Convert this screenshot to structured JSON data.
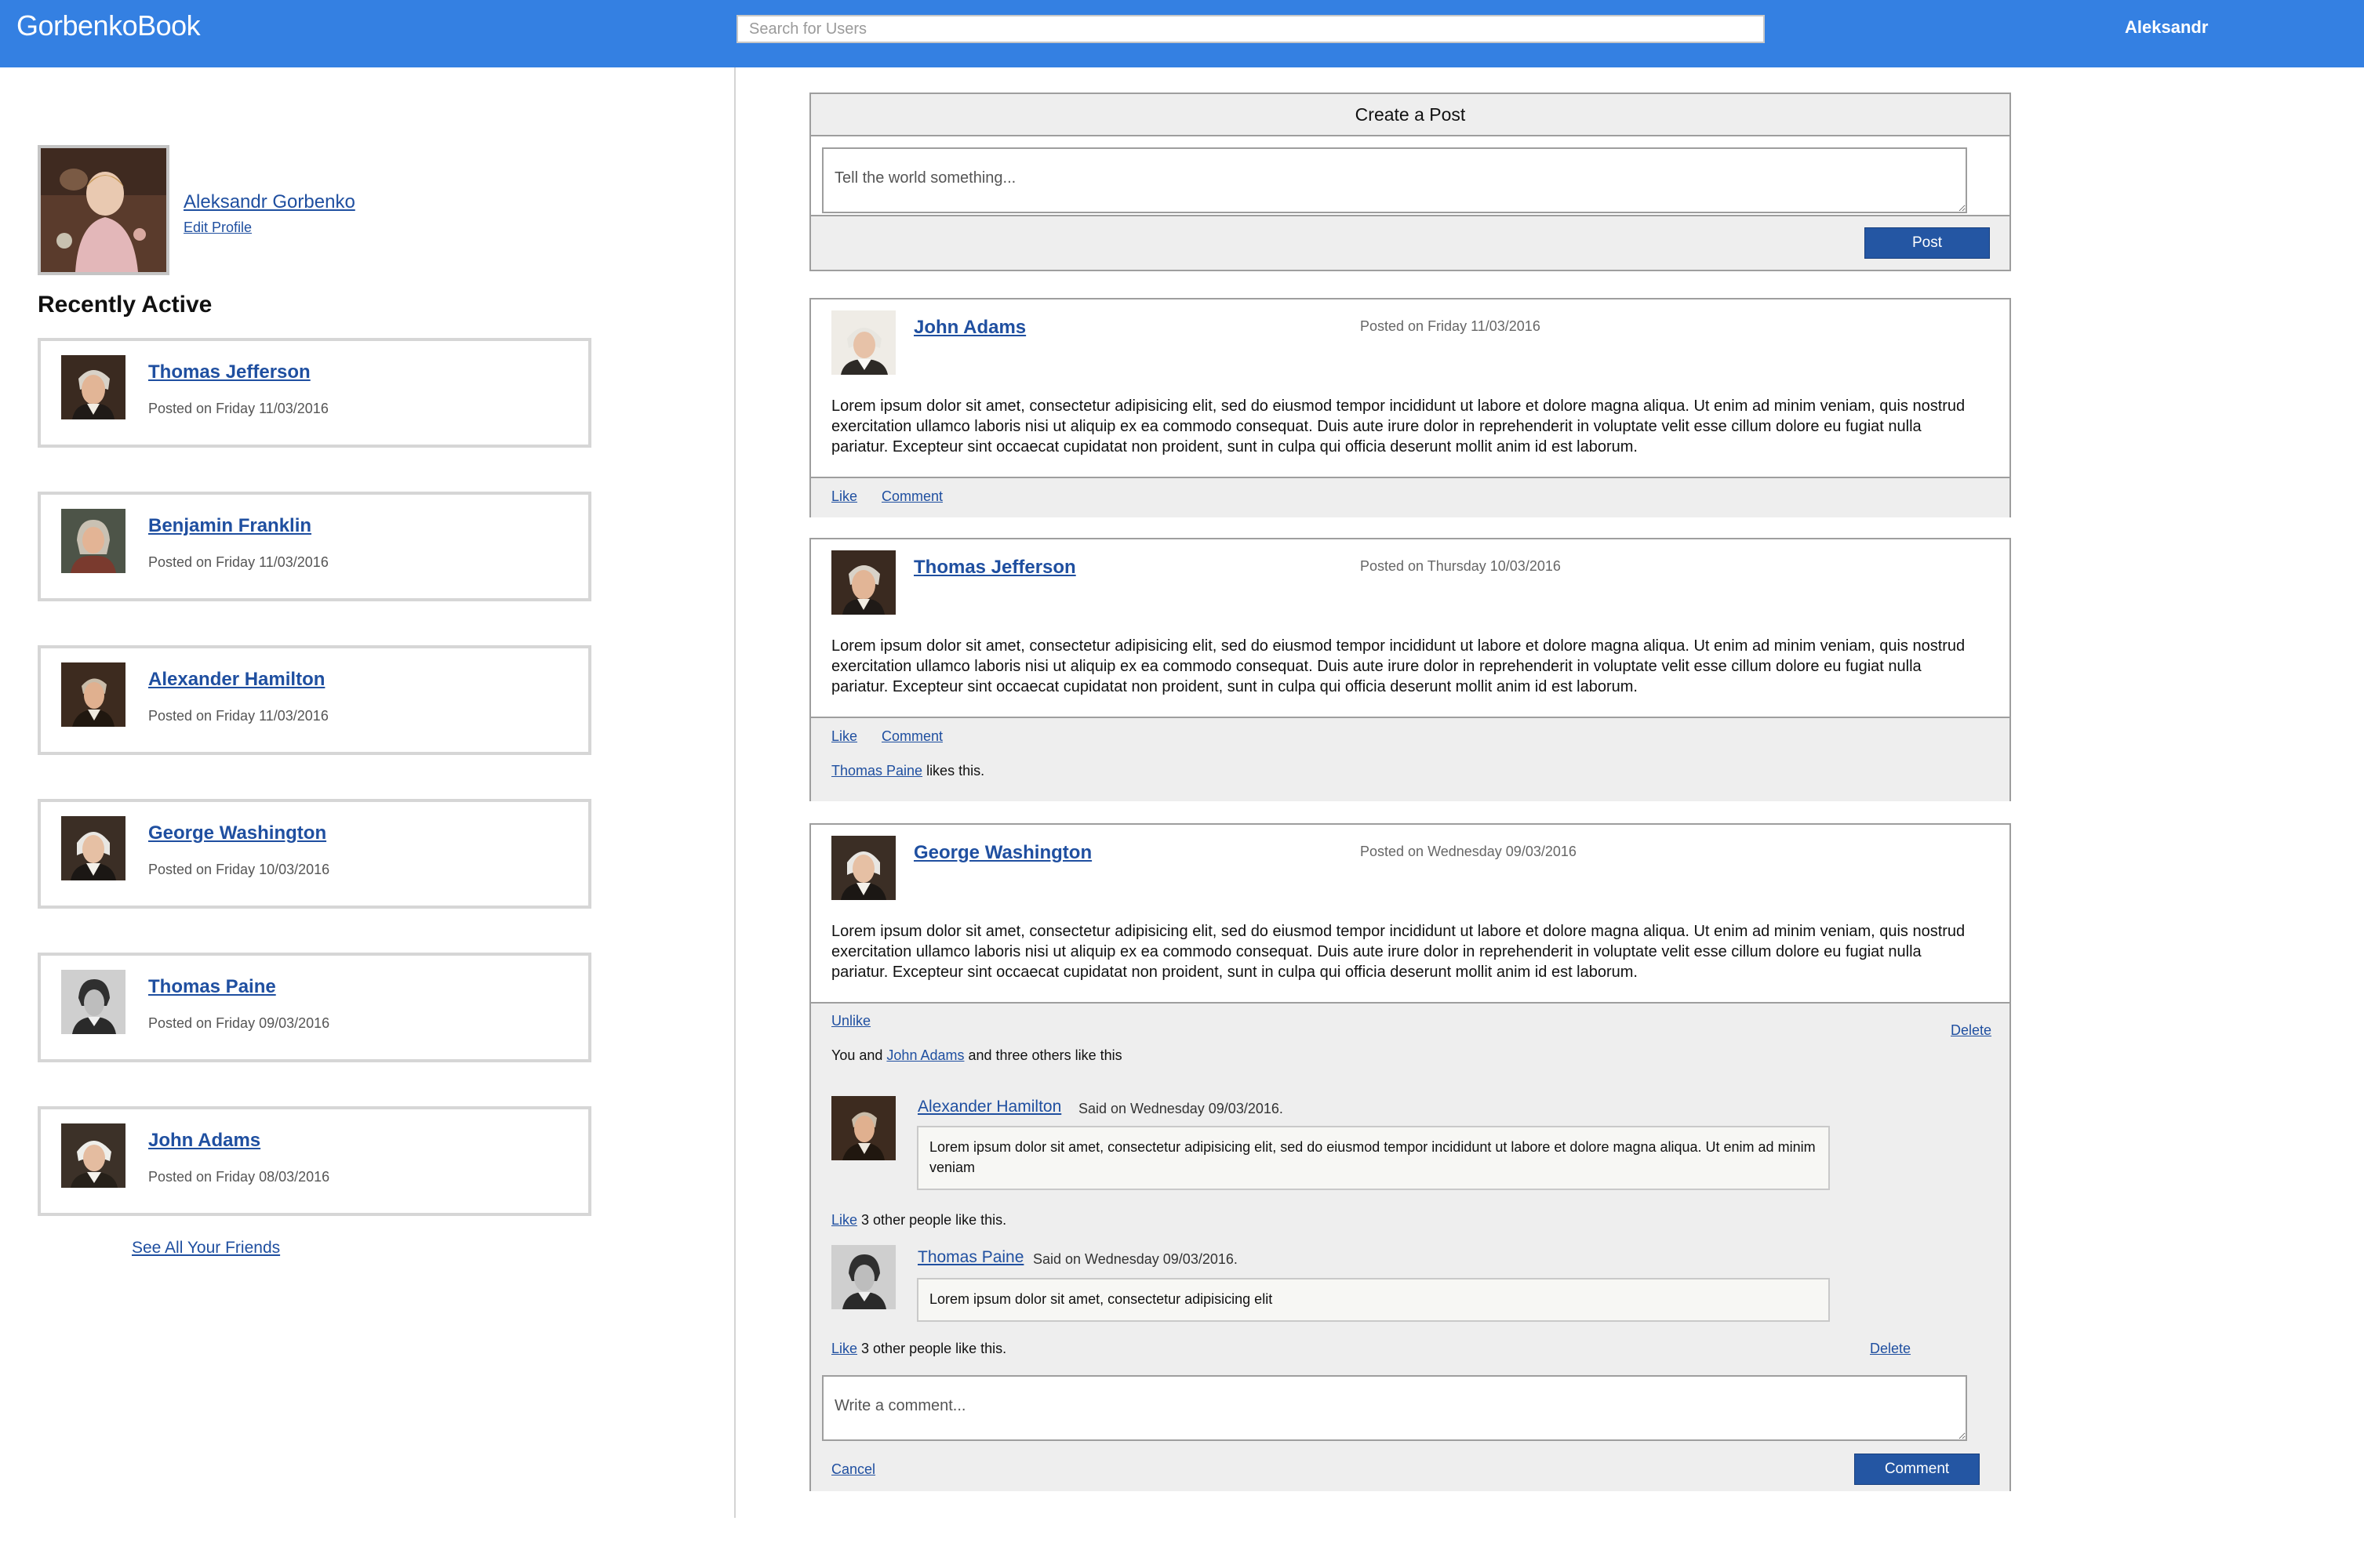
{
  "header": {
    "brand": "GorbenkoBook",
    "search_placeholder": "Search for Users",
    "user": "Aleksandr"
  },
  "profile": {
    "name": "Aleksandr Gorbenko",
    "edit": "Edit Profile"
  },
  "recently_active": {
    "title": "Recently Active",
    "friends": [
      {
        "name": "Thomas Jefferson",
        "date": "Posted on Friday 11/03/2016"
      },
      {
        "name": "Benjamin Franklin",
        "date": "Posted on Friday 11/03/2016"
      },
      {
        "name": "Alexander Hamilton",
        "date": "Posted on Friday 11/03/2016"
      },
      {
        "name": "George Washington",
        "date": "Posted on Friday 10/03/2016"
      },
      {
        "name": "Thomas Paine",
        "date": "Posted on Friday 09/03/2016"
      },
      {
        "name": "John Adams",
        "date": "Posted on Friday 08/03/2016"
      }
    ],
    "see_all": "See All Your Friends"
  },
  "create_post": {
    "title": "Create a Post",
    "placeholder": "Tell the world something...",
    "button": "Post"
  },
  "posts": [
    {
      "author": "John Adams",
      "date": "Posted on Friday 11/03/2016",
      "text": "Lorem ipsum dolor sit amet, consectetur adipisicing elit, sed do eiusmod tempor incididunt ut labore et dolore magna aliqua. Ut enim ad minim veniam, quis nostrud exercitation ullamco laboris nisi ut aliquip ex ea commodo consequat. Duis aute irure dolor in reprehenderit in voluptate velit esse cillum dolore eu fugiat nulla pariatur. Excepteur sint occaecat cupidatat non proident, sunt in culpa qui officia deserunt mollit anim id est laborum.",
      "like": "Like",
      "comment": "Comment"
    },
    {
      "author": "Thomas Jefferson",
      "date": "Posted on Thursday 10/03/2016",
      "text": "Lorem ipsum dolor sit amet, consectetur adipisicing elit, sed do eiusmod tempor incididunt ut labore et dolore magna aliqua. Ut enim ad minim veniam, quis nostrud exercitation ullamco laboris nisi ut aliquip ex ea commodo consequat. Duis aute irure dolor in reprehenderit in voluptate velit esse cillum dolore eu fugiat nulla pariatur. Excepteur sint occaecat cupidatat non proident, sunt in culpa qui officia deserunt mollit anim id est laborum.",
      "like": "Like",
      "comment": "Comment",
      "liker": "Thomas Paine",
      "likes_suffix": " likes this."
    },
    {
      "author": "George Washington",
      "date": "Posted on Wednesday 09/03/2016",
      "text": "Lorem ipsum dolor sit amet, consectetur adipisicing elit, sed do eiusmod tempor incididunt ut labore et dolore magna aliqua. Ut enim ad minim veniam, quis nostrud exercitation ullamco laboris nisi ut aliquip ex ea commodo consequat. Duis aute irure dolor in reprehenderit in voluptate velit esse cillum dolore eu fugiat nulla pariatur. Excepteur sint occaecat cupidatat non proident, sunt in culpa qui officia deserunt mollit anim id est laborum.",
      "unlike": "Unlike",
      "delete": "Delete",
      "likes_prefix": "You and ",
      "liker": "John Adams",
      "likes_suffix": " and three others like this",
      "comments": [
        {
          "author": "Alexander Hamilton",
          "said": "Said on Wednesday 09/03/2016.",
          "text": "Lorem ipsum dolor sit amet, consectetur adipisicing elit, sed do eiusmod tempor incididunt ut labore et dolore magna aliqua. Ut enim ad minim veniam",
          "like": "Like",
          "likes": " 3 other people like this."
        },
        {
          "author": "Thomas Paine",
          "said": "Said on Wednesday 09/03/2016.",
          "text": "Lorem ipsum dolor sit amet, consectetur adipisicing elit",
          "like": "Like",
          "likes": " 3 other people like this.",
          "delete": "Delete"
        }
      ],
      "comment_placeholder": "Write a comment...",
      "cancel": "Cancel",
      "comment_button": "Comment"
    }
  ]
}
